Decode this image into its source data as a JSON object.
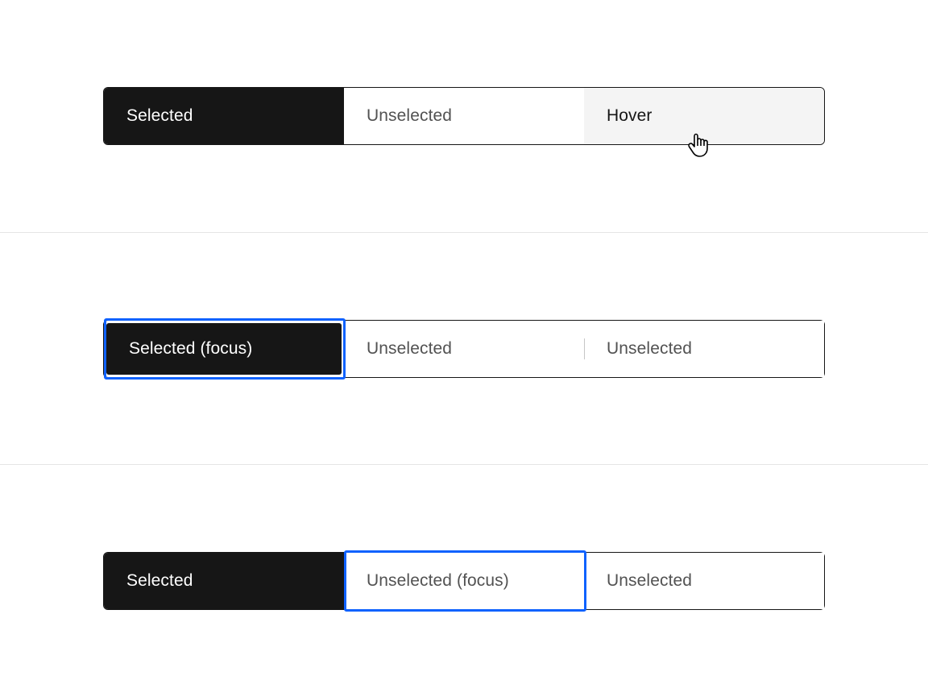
{
  "colors": {
    "focus_ring": "#0f62fe",
    "selected_bg": "#161616",
    "selected_text": "#ffffff",
    "unselected_text": "#525252",
    "hover_bg": "#f4f4f4",
    "hover_text": "#161616",
    "border": "#161616",
    "divider": "#c6c6c6"
  },
  "rows": {
    "row1": {
      "segments": [
        {
          "label": "Selected",
          "state": "selected"
        },
        {
          "label": "Unselected",
          "state": "unselected"
        },
        {
          "label": "Hover",
          "state": "hover"
        }
      ],
      "cursor": "hand"
    },
    "row2": {
      "segments": [
        {
          "label": "Selected (focus)",
          "state": "selected-focus"
        },
        {
          "label": "Unselected",
          "state": "unselected"
        },
        {
          "label": "Unselected",
          "state": "unselected"
        }
      ]
    },
    "row3": {
      "segments": [
        {
          "label": "Selected",
          "state": "selected"
        },
        {
          "label": "Unselected (focus)",
          "state": "unselected-focus"
        },
        {
          "label": "Unselected",
          "state": "unselected"
        }
      ]
    }
  }
}
